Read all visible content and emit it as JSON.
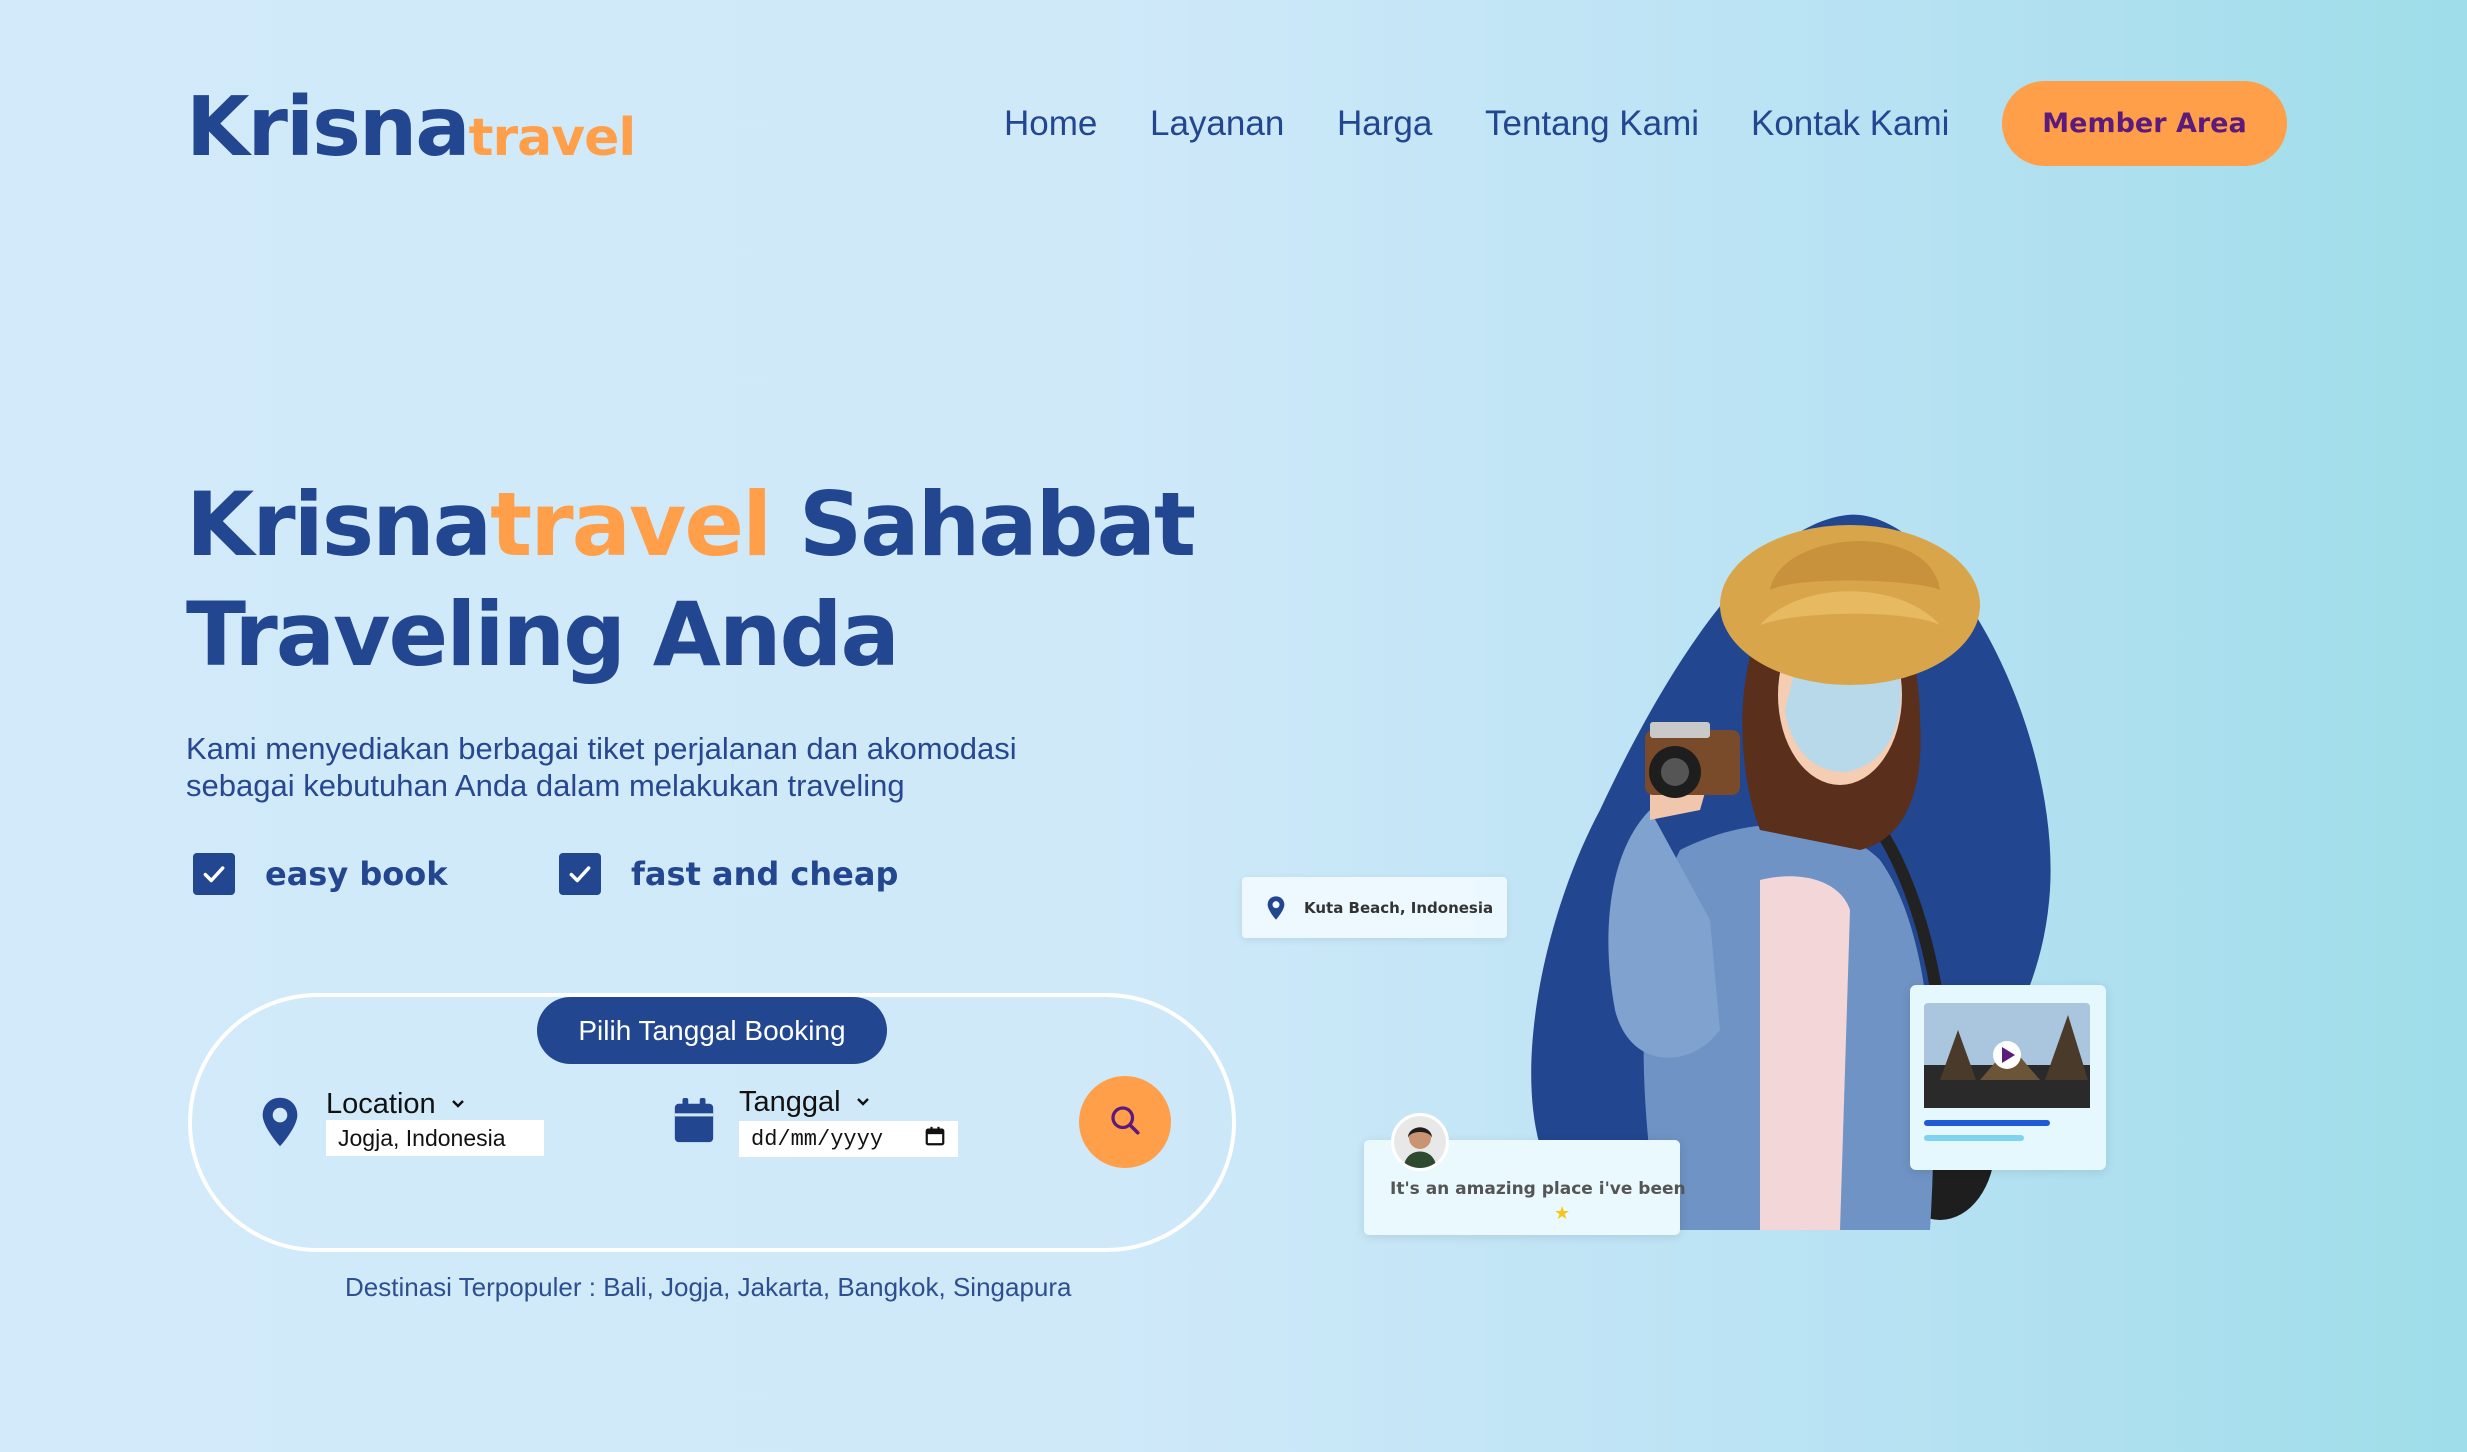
{
  "brand": {
    "name_part1": "Krisna",
    "name_part2": "travel"
  },
  "nav": {
    "items": [
      "Home",
      "Layanan",
      "Harga",
      "Tentang Kami",
      "Kontak Kami"
    ],
    "member_button": "Member Area"
  },
  "hero": {
    "title_part1": "Krisna",
    "title_part2": "travel",
    "title_part3": " Sahabat",
    "title_line2": "Traveling Anda",
    "description_line1": "Kami menyediakan berbagai tiket perjalanan dan akomodasi",
    "description_line2": "sebagai kebutuhan Anda dalam melakukan traveling",
    "features": [
      "easy book",
      "fast and cheap"
    ]
  },
  "booking": {
    "header": "Pilih Tanggal Booking",
    "location_label": "Location",
    "location_value": "Jogja, Indonesia",
    "date_label": "Tanggal",
    "date_placeholder": "dd/mm/yyyy",
    "popular": "Destinasi Terpopuler : Bali, Jogja, Jakarta, Bangkok, Singapura"
  },
  "cards": {
    "location_tag": "Kuta Beach, Indonesia",
    "review": "It's an amazing place i've been"
  },
  "colors": {
    "primary": "#22468f",
    "accent": "#ff9f4a",
    "member_text": "#5c1b7a"
  }
}
